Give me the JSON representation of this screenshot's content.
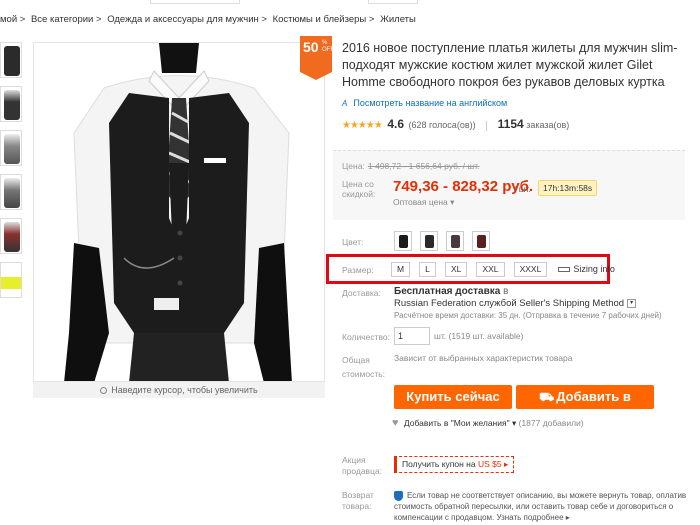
{
  "breadcrumb": [
    "мой >",
    "Все категории >",
    "Одежда и аксессуары для мужчин >",
    "Костюмы и блейзеры >",
    "Жилеты"
  ],
  "badge": {
    "percent": "50",
    "sub": "% OFF"
  },
  "product": {
    "title": "2016 новое поступление платья жилеты для мужчин slim-подходят мужские костюм жилет мужской жилет Gilet Homme свободного покроя без рукавов деловых куртка",
    "translate_icon_text": "A",
    "translate_link": "Посмотреть название на английском",
    "stars": "★★★★★",
    "rating": "4.6",
    "votes": "(628 голоса(ов))",
    "orders": "1154",
    "orders_label": "заказа(ов)"
  },
  "price": {
    "label": "Цена:",
    "old": "1 498,72 - 1 656,64 руб. / шт.",
    "discount_label": "Цена со скидкой:",
    "new": "749,36 - 828,32 руб.",
    "unit": "/ шт.",
    "timer": "17h:13m:58s",
    "wholesale": "Оптовая цена ▾"
  },
  "color": {
    "label": "Цвет:",
    "swatches": [
      "#1a1a1a",
      "#2a2a2a",
      "#4a3a3a",
      "#5a1f1f"
    ]
  },
  "size": {
    "label": "Размер:",
    "options": [
      "M",
      "L",
      "XL",
      "XXL",
      "XXXL"
    ],
    "sizing_info": "Sizing info"
  },
  "shipping": {
    "label": "Доставка:",
    "free": "Бесплатная доставка",
    "in": "в",
    "line": "Russian Federation службой Seller's Shipping Method",
    "dropdown": "▾",
    "estimate": "Расчётное время доставки: 35 дн. (Отправка в течение 7 рабочих дней)"
  },
  "quantity": {
    "label": "Количество:",
    "value": "1",
    "available": "шт. (1519 шт. available)"
  },
  "total": {
    "label": "Общая стоимость:",
    "value": "Зависит от выбранных характеристик товара"
  },
  "buttons": {
    "buy_now": "Купить сейчас",
    "add_to_cart": "Добавить в корзину",
    "cart_icon": "⛟"
  },
  "wishlist": {
    "heart": "♥",
    "label": "Добавить в \"Мои желания\" ▾",
    "count": "(1877 добавили)"
  },
  "promo": {
    "label": "Акция продавца:",
    "coupon": "Получить купон на",
    "amount": "US $5 ▸"
  },
  "returns": {
    "label": "Возврат товара:",
    "text": "Если товар не соответствует описанию, вы можете вернуть товар, оплатив стоимость обратной пересылки, или оставить товар себе и договориться о компенсации с продавцом. Узнать подробнее ▸"
  },
  "zoom_hint": "Наведите курсор, чтобы увеличить"
}
